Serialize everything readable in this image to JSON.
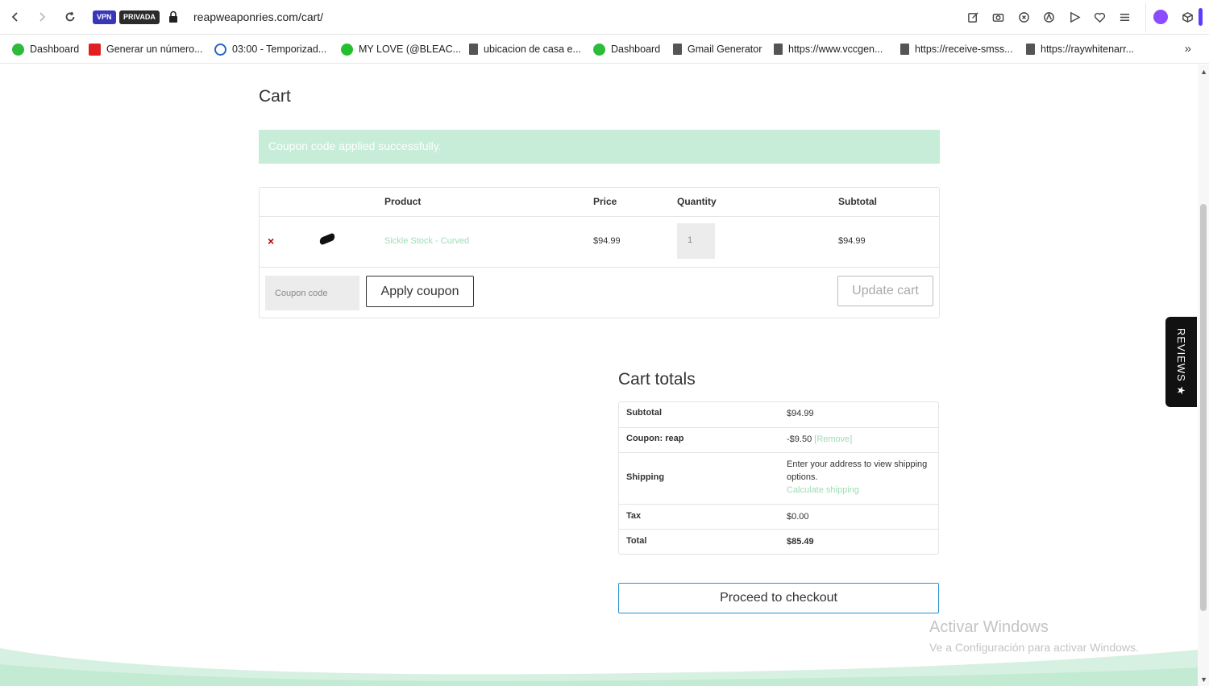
{
  "browser": {
    "url": "reapweaponries.com/cart/",
    "vpn_label": "VPN",
    "private_label": "PRIVADA"
  },
  "bookmarks": [
    {
      "label": "Dashboard",
      "icon": "green-logo-icon"
    },
    {
      "label": "Generar un número...",
      "icon": "red-f-icon"
    },
    {
      "label": "03:00 - Temporizad...",
      "icon": "timer-check-icon"
    },
    {
      "label": "MY LOVE (@BLEAC...",
      "icon": "bolt-icon"
    },
    {
      "label": "ubicacion de casa e...",
      "icon": "document-icon"
    },
    {
      "label": "Dashboard",
      "icon": "green-logo-icon"
    },
    {
      "label": "Gmail Generator",
      "icon": "document-icon"
    },
    {
      "label": "https://www.vccgen...",
      "icon": "document-icon"
    },
    {
      "label": "https://receive-smss...",
      "icon": "document-icon"
    },
    {
      "label": "https://raywhitenarr...",
      "icon": "document-icon"
    }
  ],
  "cart": {
    "title": "Cart",
    "notice": "Coupon code applied successfully.",
    "headers": {
      "product": "Product",
      "price": "Price",
      "quantity": "Quantity",
      "subtotal": "Subtotal"
    },
    "item": {
      "remove": "×",
      "name": "Sickle Stock - Curved",
      "price": "$94.99",
      "quantity": "1",
      "subtotal": "$94.99"
    },
    "coupon_placeholder": "Coupon code",
    "apply_label": "Apply coupon",
    "update_label": "Update cart"
  },
  "totals": {
    "title": "Cart totals",
    "subtotal_label": "Subtotal",
    "subtotal_value": "$94.99",
    "coupon_label": "Coupon: reap",
    "coupon_value": "-$9.50",
    "coupon_remove": "[Remove]",
    "shipping_label": "Shipping",
    "shipping_text": "Enter your address to view shipping options.",
    "shipping_link": "Calculate shipping",
    "tax_label": "Tax",
    "tax_value": "$0.00",
    "total_label": "Total",
    "total_value": "$85.49",
    "checkout_label": "Proceed to checkout"
  },
  "reviews_tab": "REVIEWS ★",
  "watermark": {
    "title": "Activar Windows",
    "subtitle": "Ve a Configuración para activar Windows."
  },
  "colors": {
    "notice_bg": "#c7ecd7",
    "link_green": "#9fdcb6",
    "remove_red": "#b80000",
    "checkout_border": "#2d8fd0"
  }
}
